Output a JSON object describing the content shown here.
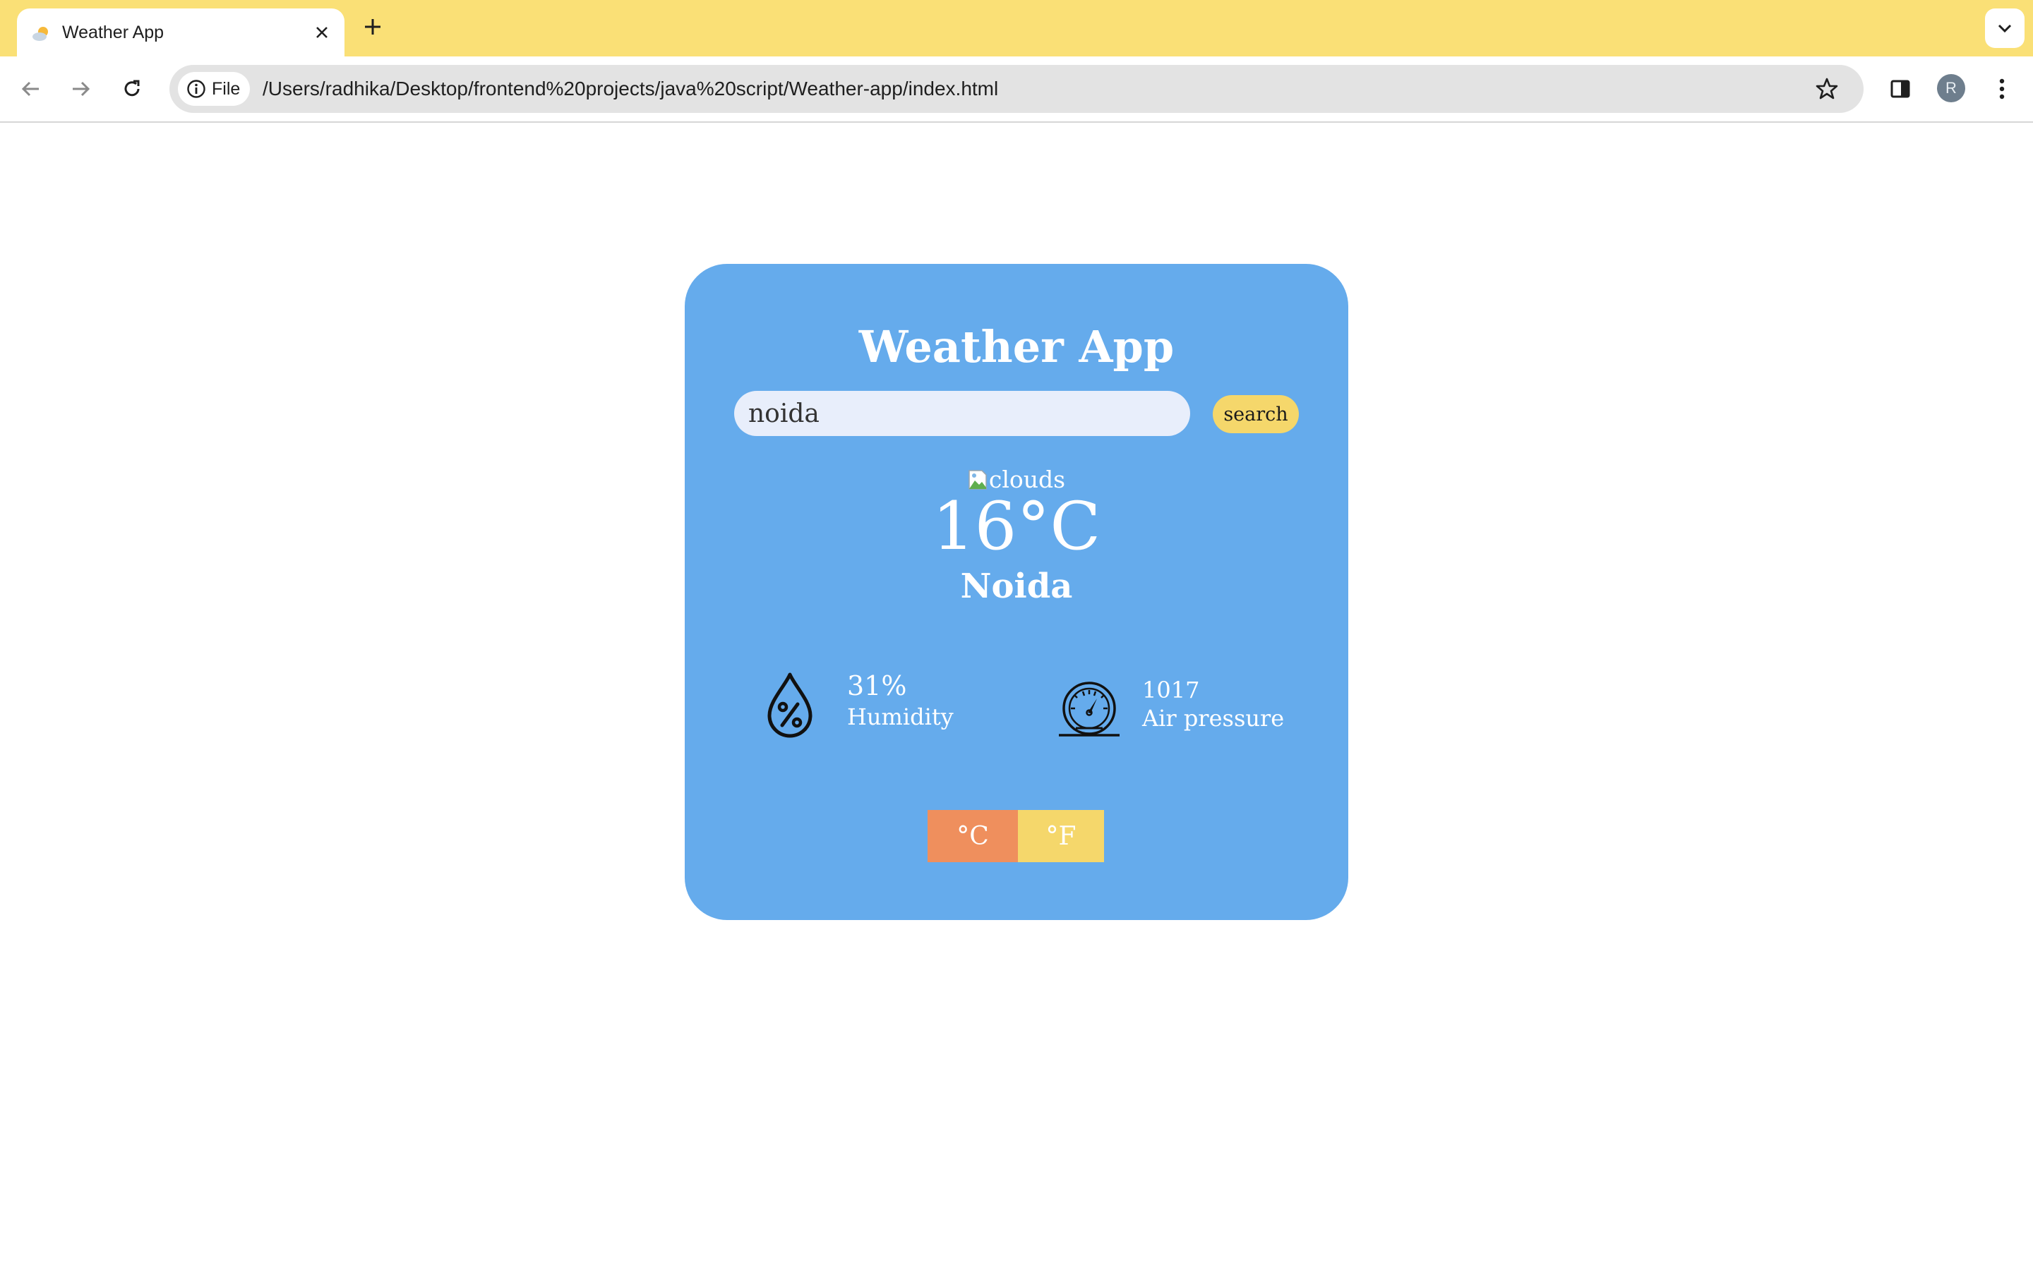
{
  "browser": {
    "tab_title": "Weather App",
    "file_chip_label": "File",
    "url": "/Users/radhika/Desktop/frontend%20projects/java%20script/Weather-app/index.html",
    "avatar_initial": "R",
    "colors": {
      "tabstrip": "#fae076",
      "omnibox": "#e3e3e3"
    }
  },
  "app": {
    "title": "Weather App",
    "search": {
      "value": "noida",
      "button_label": "search"
    },
    "weather_image_alt": "clouds",
    "temperature": "16°C",
    "city": "Noida",
    "humidity": {
      "value": "31%",
      "label": "Humidity",
      "icon": "humidity-drop-icon"
    },
    "pressure": {
      "value": "1017",
      "label": "Air pressure",
      "icon": "gauge-icon"
    },
    "units": {
      "celsius": "°C",
      "fahrenheit": "°F"
    },
    "colors": {
      "card": "#65abec",
      "search_button": "#f5d76b",
      "celsius_button": "#ef8f5d",
      "fahrenheit_button": "#f5d76b"
    }
  }
}
